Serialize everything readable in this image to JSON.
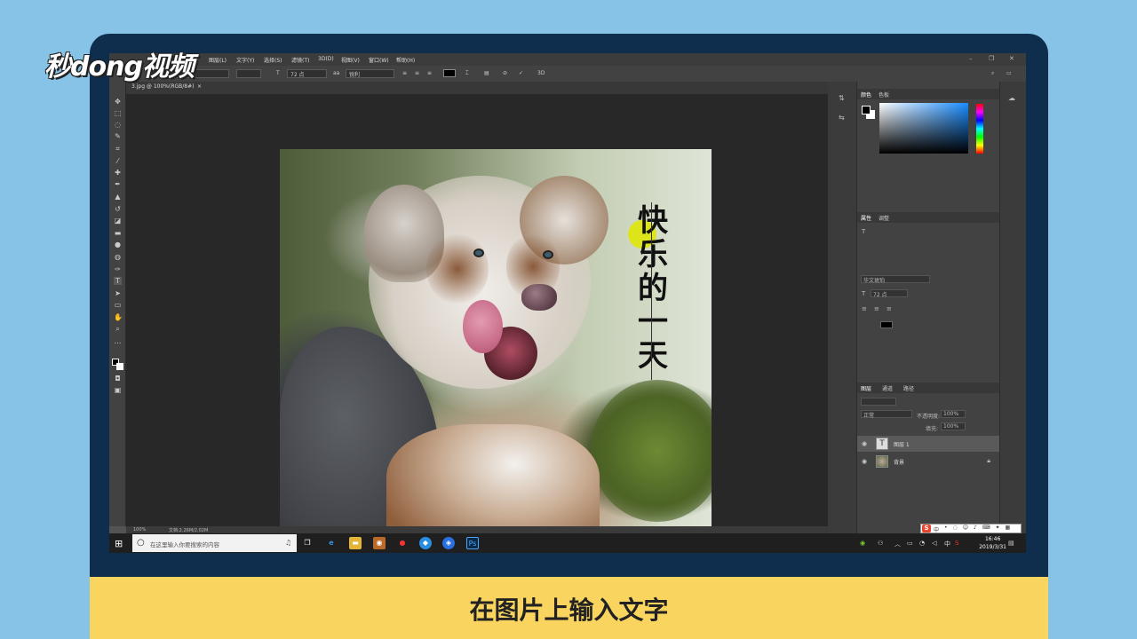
{
  "logo": "秒dong视频",
  "caption": "在图片上输入文字",
  "photoshop": {
    "menu": [
      "图层(L)",
      "文字(Y)",
      "选择(S)",
      "滤镜(T)",
      "3D(D)",
      "视图(V)",
      "窗口(W)",
      "帮助(H)"
    ],
    "options": {
      "font_size": "72 点",
      "antialias": "锐利"
    },
    "document_tab": "3.jpg @ 100%(RGB/8#)",
    "canvas_text": [
      "快",
      "乐",
      "的",
      "一",
      "天"
    ],
    "status": {
      "zoom": "100%",
      "doc": "文档:2.26M/2.02M"
    },
    "panels": {
      "color_tabs": [
        "颜色",
        "色板"
      ],
      "properties_tabs": [
        "属性",
        "调整"
      ],
      "properties_font": "华文琥珀",
      "properties_size": "72 点",
      "layers_tabs": [
        "图层",
        "通道",
        "路径"
      ],
      "blend_mode": "正常",
      "opacity_label": "不透明度:",
      "opacity_value": "100%",
      "fill_label": "填充:",
      "fill_value": "100%",
      "layers": [
        {
          "name": "图层 1",
          "thumb": "T"
        },
        {
          "name": "背景",
          "thumb": ""
        }
      ]
    }
  },
  "taskbar": {
    "search_placeholder": "在这里输入你要搜索的内容",
    "time": "16:46",
    "date": "2019/3/31",
    "ime": "中"
  }
}
